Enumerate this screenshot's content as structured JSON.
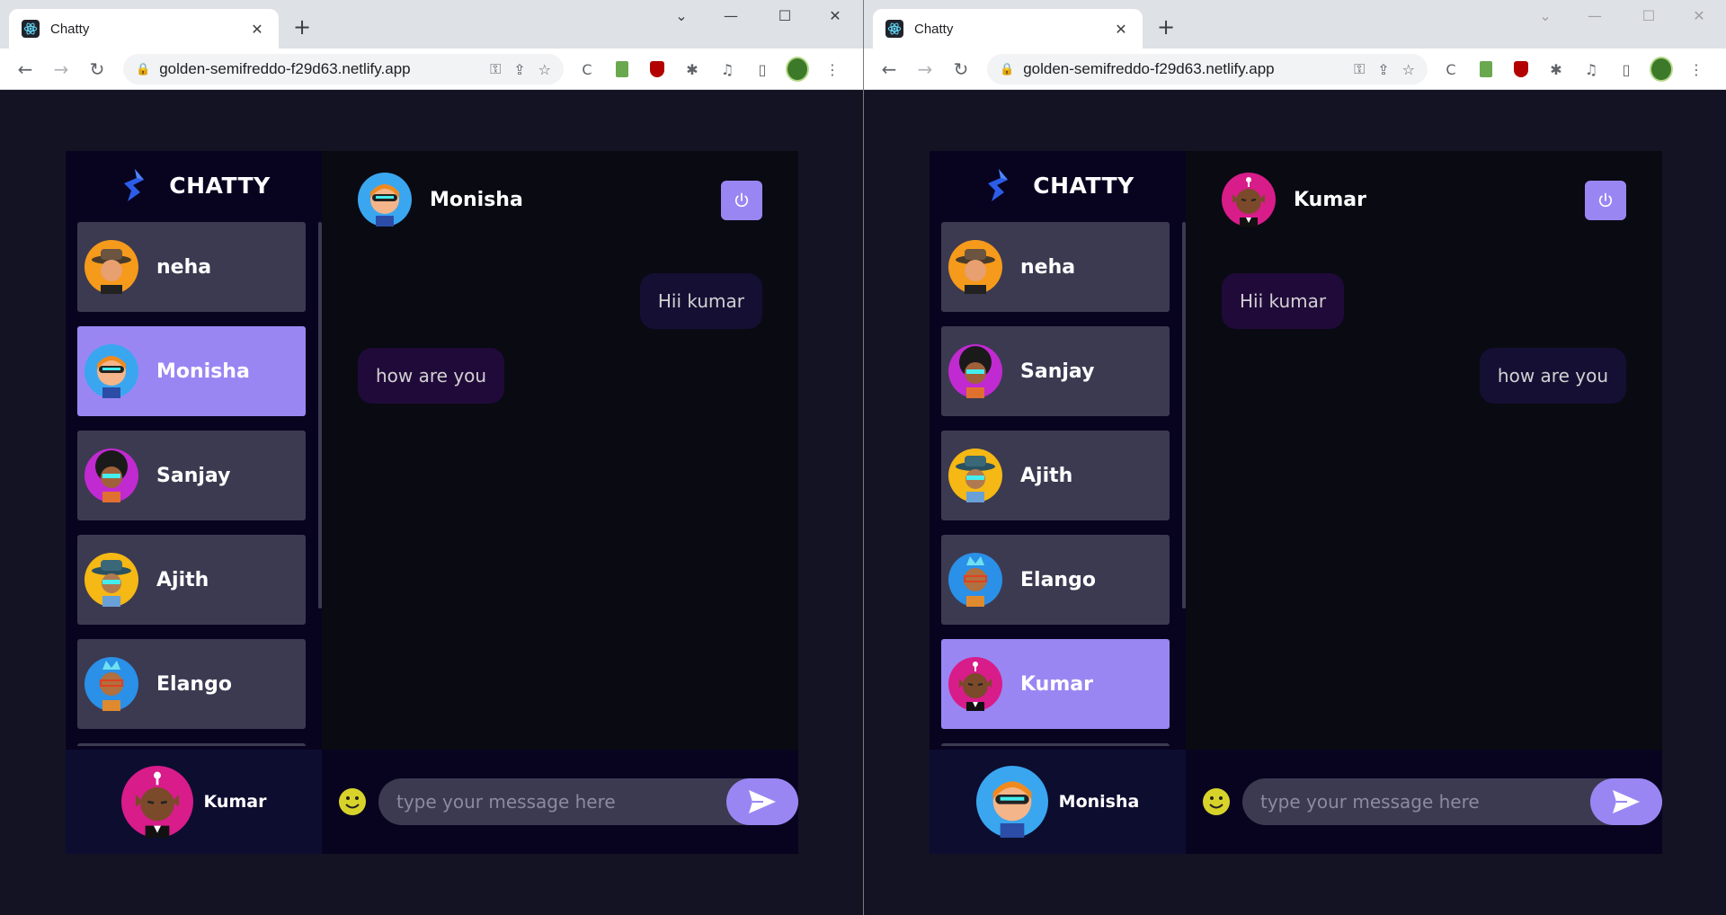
{
  "left_window": {
    "tab_title": "Chatty",
    "url": "golden-semifreddo-f29d63.netlify.app",
    "app": {
      "brand": "CHATTY",
      "contacts": [
        {
          "name": "neha"
        },
        {
          "name": "Monisha"
        },
        {
          "name": "Sanjay"
        },
        {
          "name": "Ajith"
        },
        {
          "name": "Elango"
        }
      ],
      "chat_with": "Monisha",
      "messages": [
        {
          "text": "Hii kumar",
          "direction": "sent"
        },
        {
          "text": "how are you",
          "direction": "received"
        }
      ],
      "current_user": "Kumar",
      "input_placeholder": "type your message here"
    }
  },
  "right_window": {
    "tab_title": "Chatty",
    "url": "golden-semifreddo-f29d63.netlify.app",
    "app": {
      "brand": "CHATTY",
      "contacts": [
        {
          "name": "neha"
        },
        {
          "name": "Sanjay"
        },
        {
          "name": "Ajith"
        },
        {
          "name": "Elango"
        },
        {
          "name": "Kumar"
        }
      ],
      "chat_with": "Kumar",
      "messages": [
        {
          "text": "Hii kumar",
          "direction": "received"
        },
        {
          "text": "how are you",
          "direction": "sent"
        }
      ],
      "current_user": "Monisha",
      "input_placeholder": "type your message here"
    }
  },
  "chrome": {
    "new_tab": "+",
    "close_tab": "✕",
    "minimize": "—",
    "maximize": "☐",
    "close_window": "✕",
    "tab_search": "⌄"
  },
  "icons": [
    "back-icon",
    "forward-icon",
    "reload-icon",
    "lock-icon",
    "key-icon",
    "share-icon",
    "star-icon",
    "extensions-icon",
    "sidepanel-icon",
    "menu-icon",
    "power-icon",
    "emoji-icon",
    "send-icon"
  ],
  "colors": {
    "accent": "#9a86f3",
    "app_bg": "#131324",
    "sidebar_bg": "#080420",
    "contact_bg": "#3c3a51",
    "chat_bg": "#0a0a13"
  }
}
